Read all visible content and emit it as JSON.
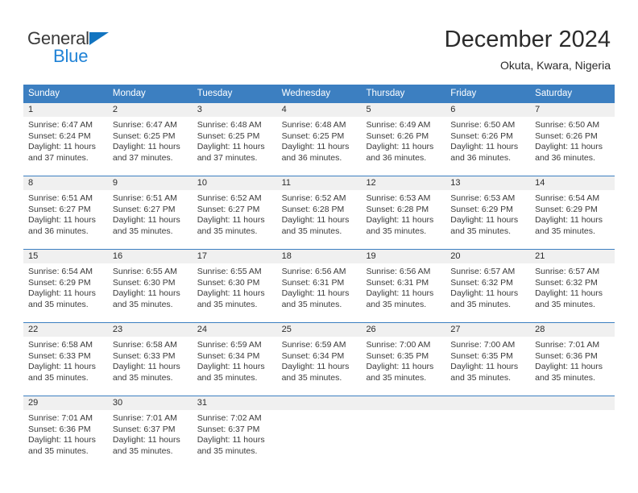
{
  "brand": {
    "name_top": "General",
    "name_bottom": "Blue",
    "flag_icon": "blue-triangle-icon",
    "accent_color": "#1274c0"
  },
  "header": {
    "title": "December 2024",
    "subtitle": "Okuta, Kwara, Nigeria"
  },
  "calendar": {
    "header_bg": "#3c7fc1",
    "day_band_bg": "#f0f0f0",
    "weekdays": [
      "Sunday",
      "Monday",
      "Tuesday",
      "Wednesday",
      "Thursday",
      "Friday",
      "Saturday"
    ],
    "weeks": [
      [
        {
          "day": "1",
          "sunrise": "Sunrise: 6:47 AM",
          "sunset": "Sunset: 6:24 PM",
          "daylight1": "Daylight: 11 hours",
          "daylight2": "and 37 minutes."
        },
        {
          "day": "2",
          "sunrise": "Sunrise: 6:47 AM",
          "sunset": "Sunset: 6:25 PM",
          "daylight1": "Daylight: 11 hours",
          "daylight2": "and 37 minutes."
        },
        {
          "day": "3",
          "sunrise": "Sunrise: 6:48 AM",
          "sunset": "Sunset: 6:25 PM",
          "daylight1": "Daylight: 11 hours",
          "daylight2": "and 37 minutes."
        },
        {
          "day": "4",
          "sunrise": "Sunrise: 6:48 AM",
          "sunset": "Sunset: 6:25 PM",
          "daylight1": "Daylight: 11 hours",
          "daylight2": "and 36 minutes."
        },
        {
          "day": "5",
          "sunrise": "Sunrise: 6:49 AM",
          "sunset": "Sunset: 6:26 PM",
          "daylight1": "Daylight: 11 hours",
          "daylight2": "and 36 minutes."
        },
        {
          "day": "6",
          "sunrise": "Sunrise: 6:50 AM",
          "sunset": "Sunset: 6:26 PM",
          "daylight1": "Daylight: 11 hours",
          "daylight2": "and 36 minutes."
        },
        {
          "day": "7",
          "sunrise": "Sunrise: 6:50 AM",
          "sunset": "Sunset: 6:26 PM",
          "daylight1": "Daylight: 11 hours",
          "daylight2": "and 36 minutes."
        }
      ],
      [
        {
          "day": "8",
          "sunrise": "Sunrise: 6:51 AM",
          "sunset": "Sunset: 6:27 PM",
          "daylight1": "Daylight: 11 hours",
          "daylight2": "and 36 minutes."
        },
        {
          "day": "9",
          "sunrise": "Sunrise: 6:51 AM",
          "sunset": "Sunset: 6:27 PM",
          "daylight1": "Daylight: 11 hours",
          "daylight2": "and 35 minutes."
        },
        {
          "day": "10",
          "sunrise": "Sunrise: 6:52 AM",
          "sunset": "Sunset: 6:27 PM",
          "daylight1": "Daylight: 11 hours",
          "daylight2": "and 35 minutes."
        },
        {
          "day": "11",
          "sunrise": "Sunrise: 6:52 AM",
          "sunset": "Sunset: 6:28 PM",
          "daylight1": "Daylight: 11 hours",
          "daylight2": "and 35 minutes."
        },
        {
          "day": "12",
          "sunrise": "Sunrise: 6:53 AM",
          "sunset": "Sunset: 6:28 PM",
          "daylight1": "Daylight: 11 hours",
          "daylight2": "and 35 minutes."
        },
        {
          "day": "13",
          "sunrise": "Sunrise: 6:53 AM",
          "sunset": "Sunset: 6:29 PM",
          "daylight1": "Daylight: 11 hours",
          "daylight2": "and 35 minutes."
        },
        {
          "day": "14",
          "sunrise": "Sunrise: 6:54 AM",
          "sunset": "Sunset: 6:29 PM",
          "daylight1": "Daylight: 11 hours",
          "daylight2": "and 35 minutes."
        }
      ],
      [
        {
          "day": "15",
          "sunrise": "Sunrise: 6:54 AM",
          "sunset": "Sunset: 6:29 PM",
          "daylight1": "Daylight: 11 hours",
          "daylight2": "and 35 minutes."
        },
        {
          "day": "16",
          "sunrise": "Sunrise: 6:55 AM",
          "sunset": "Sunset: 6:30 PM",
          "daylight1": "Daylight: 11 hours",
          "daylight2": "and 35 minutes."
        },
        {
          "day": "17",
          "sunrise": "Sunrise: 6:55 AM",
          "sunset": "Sunset: 6:30 PM",
          "daylight1": "Daylight: 11 hours",
          "daylight2": "and 35 minutes."
        },
        {
          "day": "18",
          "sunrise": "Sunrise: 6:56 AM",
          "sunset": "Sunset: 6:31 PM",
          "daylight1": "Daylight: 11 hours",
          "daylight2": "and 35 minutes."
        },
        {
          "day": "19",
          "sunrise": "Sunrise: 6:56 AM",
          "sunset": "Sunset: 6:31 PM",
          "daylight1": "Daylight: 11 hours",
          "daylight2": "and 35 minutes."
        },
        {
          "day": "20",
          "sunrise": "Sunrise: 6:57 AM",
          "sunset": "Sunset: 6:32 PM",
          "daylight1": "Daylight: 11 hours",
          "daylight2": "and 35 minutes."
        },
        {
          "day": "21",
          "sunrise": "Sunrise: 6:57 AM",
          "sunset": "Sunset: 6:32 PM",
          "daylight1": "Daylight: 11 hours",
          "daylight2": "and 35 minutes."
        }
      ],
      [
        {
          "day": "22",
          "sunrise": "Sunrise: 6:58 AM",
          "sunset": "Sunset: 6:33 PM",
          "daylight1": "Daylight: 11 hours",
          "daylight2": "and 35 minutes."
        },
        {
          "day": "23",
          "sunrise": "Sunrise: 6:58 AM",
          "sunset": "Sunset: 6:33 PM",
          "daylight1": "Daylight: 11 hours",
          "daylight2": "and 35 minutes."
        },
        {
          "day": "24",
          "sunrise": "Sunrise: 6:59 AM",
          "sunset": "Sunset: 6:34 PM",
          "daylight1": "Daylight: 11 hours",
          "daylight2": "and 35 minutes."
        },
        {
          "day": "25",
          "sunrise": "Sunrise: 6:59 AM",
          "sunset": "Sunset: 6:34 PM",
          "daylight1": "Daylight: 11 hours",
          "daylight2": "and 35 minutes."
        },
        {
          "day": "26",
          "sunrise": "Sunrise: 7:00 AM",
          "sunset": "Sunset: 6:35 PM",
          "daylight1": "Daylight: 11 hours",
          "daylight2": "and 35 minutes."
        },
        {
          "day": "27",
          "sunrise": "Sunrise: 7:00 AM",
          "sunset": "Sunset: 6:35 PM",
          "daylight1": "Daylight: 11 hours",
          "daylight2": "and 35 minutes."
        },
        {
          "day": "28",
          "sunrise": "Sunrise: 7:01 AM",
          "sunset": "Sunset: 6:36 PM",
          "daylight1": "Daylight: 11 hours",
          "daylight2": "and 35 minutes."
        }
      ],
      [
        {
          "day": "29",
          "sunrise": "Sunrise: 7:01 AM",
          "sunset": "Sunset: 6:36 PM",
          "daylight1": "Daylight: 11 hours",
          "daylight2": "and 35 minutes."
        },
        {
          "day": "30",
          "sunrise": "Sunrise: 7:01 AM",
          "sunset": "Sunset: 6:37 PM",
          "daylight1": "Daylight: 11 hours",
          "daylight2": "and 35 minutes."
        },
        {
          "day": "31",
          "sunrise": "Sunrise: 7:02 AM",
          "sunset": "Sunset: 6:37 PM",
          "daylight1": "Daylight: 11 hours",
          "daylight2": "and 35 minutes."
        },
        {
          "day": "",
          "sunrise": "",
          "sunset": "",
          "daylight1": "",
          "daylight2": ""
        },
        {
          "day": "",
          "sunrise": "",
          "sunset": "",
          "daylight1": "",
          "daylight2": ""
        },
        {
          "day": "",
          "sunrise": "",
          "sunset": "",
          "daylight1": "",
          "daylight2": ""
        },
        {
          "day": "",
          "sunrise": "",
          "sunset": "",
          "daylight1": "",
          "daylight2": ""
        }
      ]
    ]
  }
}
